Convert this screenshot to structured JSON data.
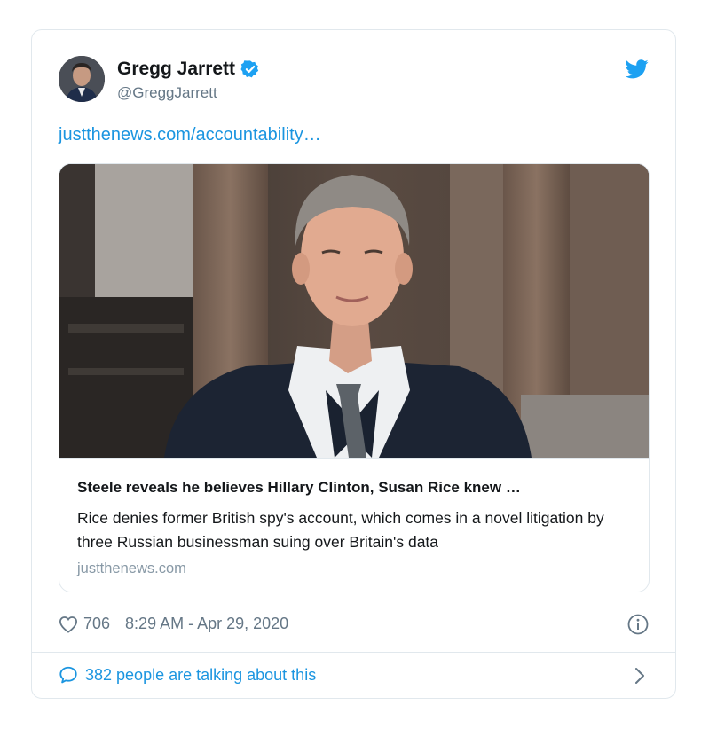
{
  "tweet": {
    "author_name": "Gregg Jarrett",
    "author_handle": "@GreggJarrett",
    "link_text": "justthenews.com/accountability…",
    "card": {
      "title": "Steele reveals he believes Hillary Clinton, Susan Rice knew …",
      "description": "Rice denies former British spy's account, which comes in a novel litigation by three Russian businessman suing over Britain's data",
      "domain": "justthenews.com"
    },
    "likes": "706",
    "timestamp": "8:29 AM - Apr 29, 2020",
    "talking_text": "382 people are talking about this"
  },
  "icons": {
    "verified": "verified-badge-icon",
    "bird": "twitter-bird-icon",
    "heart": "heart-icon",
    "info": "info-icon",
    "bubble": "speech-bubble-icon",
    "chevron": "chevron-right-icon"
  },
  "colors": {
    "accent": "#1da1f2",
    "link": "#1b95e0",
    "muted": "#657786",
    "border": "#e1e8ed"
  }
}
